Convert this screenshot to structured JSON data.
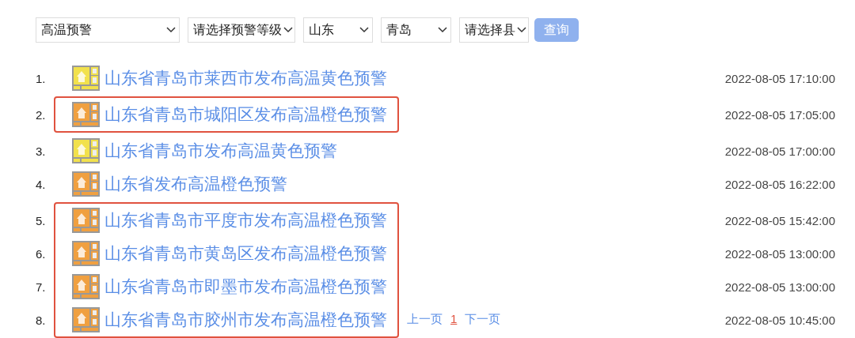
{
  "filters": [
    {
      "value": "高温预警"
    },
    {
      "value": "请选择预警等级"
    },
    {
      "value": "山东"
    },
    {
      "value": "青岛"
    },
    {
      "value": "请选择县"
    }
  ],
  "search_button": "查询",
  "warnings": [
    {
      "number": "1.",
      "title": "山东省青岛市莱西市发布高温黄色预警",
      "time": "2022-08-05 17:10:00",
      "color": "#f2e14c",
      "highlighted": false
    },
    {
      "number": "2.",
      "title": "山东省青岛市城阳区发布高温橙色预警",
      "time": "2022-08-05 17:05:00",
      "color": "#f0a040",
      "highlighted": true
    },
    {
      "number": "3.",
      "title": "山东省青岛市发布高温黄色预警",
      "time": "2022-08-05 17:00:00",
      "color": "#f2e14c",
      "highlighted": false
    },
    {
      "number": "4.",
      "title": "山东省发布高温橙色预警",
      "time": "2022-08-05 16:22:00",
      "color": "#f0a040",
      "highlighted": false
    },
    {
      "number": "5.",
      "title": "山东省青岛市平度市发布高温橙色预警",
      "time": "2022-08-05 15:42:00",
      "color": "#f0a040",
      "highlighted": true
    },
    {
      "number": "6.",
      "title": "山东省青岛市黄岛区发布高温橙色预警",
      "time": "2022-08-05 13:00:00",
      "color": "#f0a040",
      "highlighted": true
    },
    {
      "number": "7.",
      "title": "山东省青岛市即墨市发布高温橙色预警",
      "time": "2022-08-05 13:00:00",
      "color": "#f0a040",
      "highlighted": true
    },
    {
      "number": "8.",
      "title": "山东省青岛市胶州市发布高温橙色预警",
      "time": "2022-08-05 10:45:00",
      "color": "#f0a040",
      "highlighted": true
    }
  ],
  "pagination": {
    "previous": "上一页",
    "pages": [
      {
        "label": "1",
        "selected": true
      }
    ],
    "next": "下一页"
  }
}
